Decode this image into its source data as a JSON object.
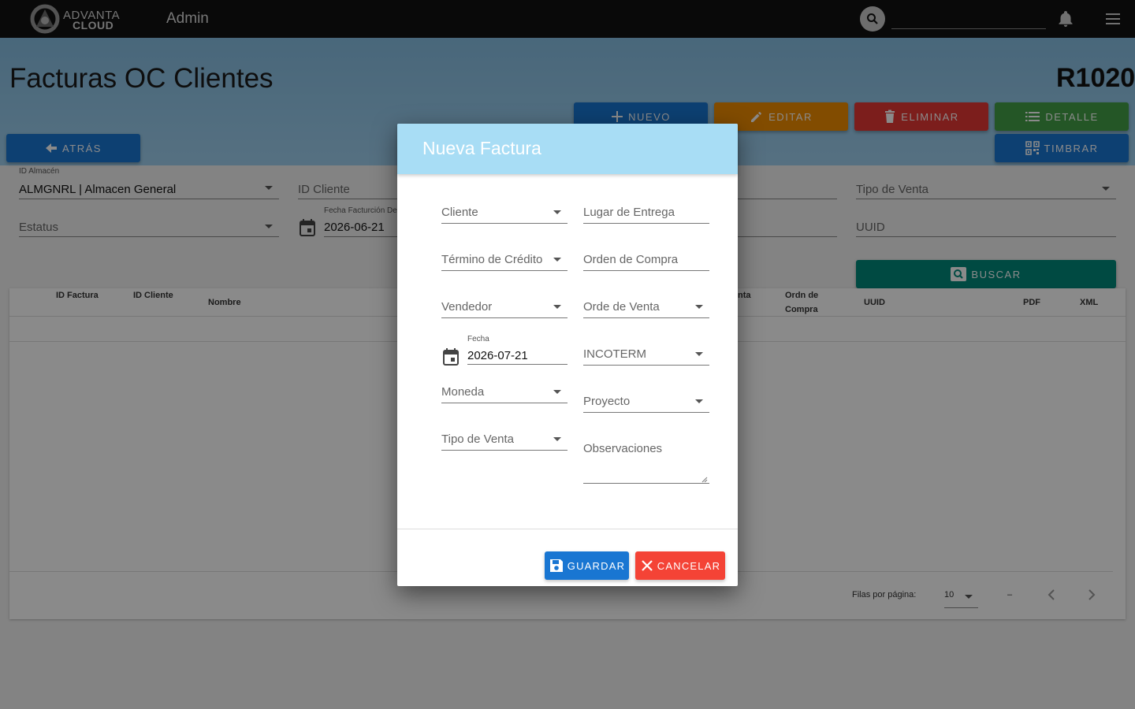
{
  "topbar": {
    "logo_line1": "ADVANTA",
    "logo_line2": "CLOUD",
    "title": "Admin"
  },
  "header": {
    "page_title": "Facturas OC Clientes",
    "page_code": "R1020"
  },
  "actions": {
    "nuevo": "NUEVO",
    "editar": "EDITAR",
    "eliminar": "ELIMINAR",
    "detalle": "DETALLE",
    "atras": "ATRÁS",
    "timbrar": "TIMBRAR",
    "buscar": "BUSCAR"
  },
  "filters": {
    "almacen_label": "ID Almacén",
    "almacen_value": "ALMGNRL | Almacen General",
    "cliente_placeholder": "ID Cliente",
    "tipo_venta_placeholder": "Tipo de Venta",
    "estatus_placeholder": "Estatus",
    "fecha_label": "Fecha Facturción De",
    "fecha_value": "2026-06-21",
    "uuid_placeholder": "UUID"
  },
  "table": {
    "headers": {
      "id_factura": "ID Factura",
      "id_cliente": "ID Cliente",
      "nombre": "Nombre",
      "venta_partial": "nta",
      "orden_compra_1": "Ordn de",
      "orden_compra_2": "Compra",
      "uuid": "UUID",
      "pdf": "PDF",
      "xml": "XML"
    },
    "pager": {
      "rows_label": "Filas por página:",
      "rows_value": "10",
      "range": "–"
    }
  },
  "modal": {
    "title": "Nueva Factura",
    "fields": {
      "cliente": "Cliente",
      "lugar_entrega": "Lugar de Entrega",
      "termino_credito": "Término de Crédito",
      "orden_compra": "Orden de Compra",
      "vendedor": "Vendedor",
      "orden_venta": "Orde de Venta",
      "fecha_label": "Fecha",
      "fecha_value": "2026-07-21",
      "incoterm": "INCOTERM",
      "moneda": "Moneda",
      "proyecto": "Proyecto",
      "tipo_venta": "Tipo de Venta",
      "observaciones": "Observaciones"
    },
    "guardar": "GUARDAR",
    "cancelar": "CANCELAR"
  },
  "colors": {
    "topbar": "#111111",
    "header_band": "#9fd0ef",
    "nuevo": "#1976d2",
    "editar": "#f08c00",
    "eliminar": "#e53935",
    "detalle": "#43a047",
    "buscar": "#00897b",
    "modal_header": "#a8ddf5",
    "cancelar": "#f44336"
  },
  "icons": {
    "search": "search-icon",
    "bell": "bell-icon",
    "menu": "menu-icon",
    "plus": "plus-icon",
    "pencil": "pencil-icon",
    "trash": "trash-icon",
    "list": "list-icon",
    "arrow": "arrow-left-icon",
    "qr": "qr-icon",
    "calendar": "calendar-icon",
    "save": "save-icon",
    "close": "close-icon"
  }
}
